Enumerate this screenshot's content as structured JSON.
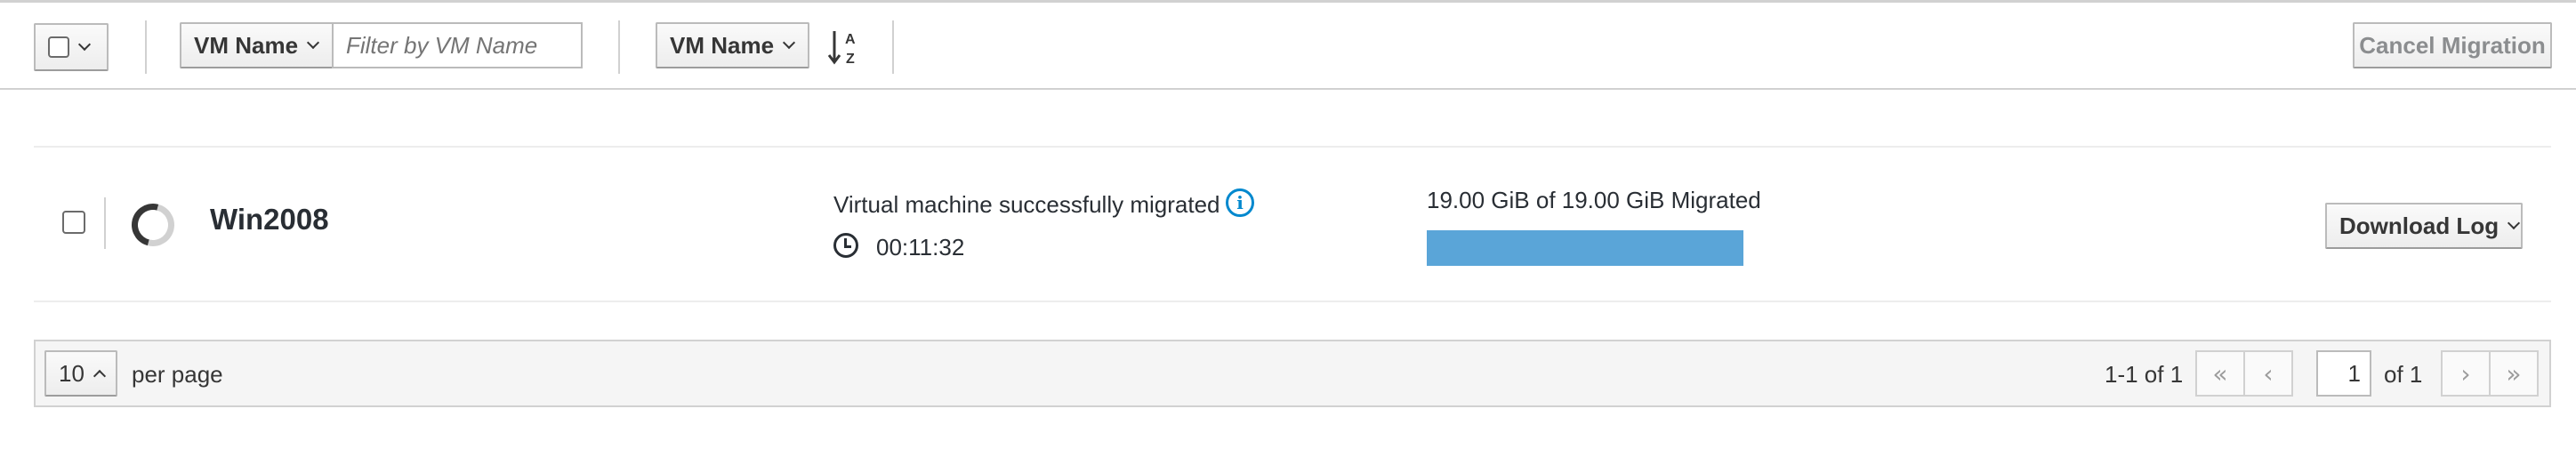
{
  "toolbar": {
    "filter_field": "VM Name",
    "filter_placeholder": "Filter by VM Name",
    "sort_field": "VM Name",
    "sort_icon": "sort-alpha-asc-icon",
    "cancel_label": "Cancel Migration"
  },
  "row": {
    "vm_name": "Win2008",
    "status": "Virtual machine successfully migrated",
    "elapsed": "00:11:32",
    "progress_label": "19.00 GiB of 19.00 GiB Migrated",
    "progress_percent": 100,
    "download_label": "Download Log"
  },
  "pagination": {
    "per_page_value": "10",
    "per_page_label": "per page",
    "range": "1-1 of 1",
    "current_page": "1",
    "of_pages": "of 1"
  },
  "colors": {
    "progress": "#5aa5d8",
    "info": "#0088ce"
  }
}
